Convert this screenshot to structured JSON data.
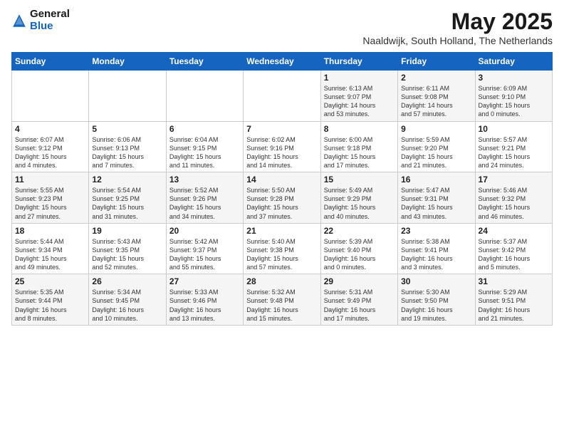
{
  "logo": {
    "general": "General",
    "blue": "Blue"
  },
  "title": "May 2025",
  "subtitle": "Naaldwijk, South Holland, The Netherlands",
  "days_of_week": [
    "Sunday",
    "Monday",
    "Tuesday",
    "Wednesday",
    "Thursday",
    "Friday",
    "Saturday"
  ],
  "weeks": [
    [
      {
        "day": "",
        "info": ""
      },
      {
        "day": "",
        "info": ""
      },
      {
        "day": "",
        "info": ""
      },
      {
        "day": "",
        "info": ""
      },
      {
        "day": "1",
        "info": "Sunrise: 6:13 AM\nSunset: 9:07 PM\nDaylight: 14 hours\nand 53 minutes."
      },
      {
        "day": "2",
        "info": "Sunrise: 6:11 AM\nSunset: 9:08 PM\nDaylight: 14 hours\nand 57 minutes."
      },
      {
        "day": "3",
        "info": "Sunrise: 6:09 AM\nSunset: 9:10 PM\nDaylight: 15 hours\nand 0 minutes."
      }
    ],
    [
      {
        "day": "4",
        "info": "Sunrise: 6:07 AM\nSunset: 9:12 PM\nDaylight: 15 hours\nand 4 minutes."
      },
      {
        "day": "5",
        "info": "Sunrise: 6:06 AM\nSunset: 9:13 PM\nDaylight: 15 hours\nand 7 minutes."
      },
      {
        "day": "6",
        "info": "Sunrise: 6:04 AM\nSunset: 9:15 PM\nDaylight: 15 hours\nand 11 minutes."
      },
      {
        "day": "7",
        "info": "Sunrise: 6:02 AM\nSunset: 9:16 PM\nDaylight: 15 hours\nand 14 minutes."
      },
      {
        "day": "8",
        "info": "Sunrise: 6:00 AM\nSunset: 9:18 PM\nDaylight: 15 hours\nand 17 minutes."
      },
      {
        "day": "9",
        "info": "Sunrise: 5:59 AM\nSunset: 9:20 PM\nDaylight: 15 hours\nand 21 minutes."
      },
      {
        "day": "10",
        "info": "Sunrise: 5:57 AM\nSunset: 9:21 PM\nDaylight: 15 hours\nand 24 minutes."
      }
    ],
    [
      {
        "day": "11",
        "info": "Sunrise: 5:55 AM\nSunset: 9:23 PM\nDaylight: 15 hours\nand 27 minutes."
      },
      {
        "day": "12",
        "info": "Sunrise: 5:54 AM\nSunset: 9:25 PM\nDaylight: 15 hours\nand 31 minutes."
      },
      {
        "day": "13",
        "info": "Sunrise: 5:52 AM\nSunset: 9:26 PM\nDaylight: 15 hours\nand 34 minutes."
      },
      {
        "day": "14",
        "info": "Sunrise: 5:50 AM\nSunset: 9:28 PM\nDaylight: 15 hours\nand 37 minutes."
      },
      {
        "day": "15",
        "info": "Sunrise: 5:49 AM\nSunset: 9:29 PM\nDaylight: 15 hours\nand 40 minutes."
      },
      {
        "day": "16",
        "info": "Sunrise: 5:47 AM\nSunset: 9:31 PM\nDaylight: 15 hours\nand 43 minutes."
      },
      {
        "day": "17",
        "info": "Sunrise: 5:46 AM\nSunset: 9:32 PM\nDaylight: 15 hours\nand 46 minutes."
      }
    ],
    [
      {
        "day": "18",
        "info": "Sunrise: 5:44 AM\nSunset: 9:34 PM\nDaylight: 15 hours\nand 49 minutes."
      },
      {
        "day": "19",
        "info": "Sunrise: 5:43 AM\nSunset: 9:35 PM\nDaylight: 15 hours\nand 52 minutes."
      },
      {
        "day": "20",
        "info": "Sunrise: 5:42 AM\nSunset: 9:37 PM\nDaylight: 15 hours\nand 55 minutes."
      },
      {
        "day": "21",
        "info": "Sunrise: 5:40 AM\nSunset: 9:38 PM\nDaylight: 15 hours\nand 57 minutes."
      },
      {
        "day": "22",
        "info": "Sunrise: 5:39 AM\nSunset: 9:40 PM\nDaylight: 16 hours\nand 0 minutes."
      },
      {
        "day": "23",
        "info": "Sunrise: 5:38 AM\nSunset: 9:41 PM\nDaylight: 16 hours\nand 3 minutes."
      },
      {
        "day": "24",
        "info": "Sunrise: 5:37 AM\nSunset: 9:42 PM\nDaylight: 16 hours\nand 5 minutes."
      }
    ],
    [
      {
        "day": "25",
        "info": "Sunrise: 5:35 AM\nSunset: 9:44 PM\nDaylight: 16 hours\nand 8 minutes."
      },
      {
        "day": "26",
        "info": "Sunrise: 5:34 AM\nSunset: 9:45 PM\nDaylight: 16 hours\nand 10 minutes."
      },
      {
        "day": "27",
        "info": "Sunrise: 5:33 AM\nSunset: 9:46 PM\nDaylight: 16 hours\nand 13 minutes."
      },
      {
        "day": "28",
        "info": "Sunrise: 5:32 AM\nSunset: 9:48 PM\nDaylight: 16 hours\nand 15 minutes."
      },
      {
        "day": "29",
        "info": "Sunrise: 5:31 AM\nSunset: 9:49 PM\nDaylight: 16 hours\nand 17 minutes."
      },
      {
        "day": "30",
        "info": "Sunrise: 5:30 AM\nSunset: 9:50 PM\nDaylight: 16 hours\nand 19 minutes."
      },
      {
        "day": "31",
        "info": "Sunrise: 5:29 AM\nSunset: 9:51 PM\nDaylight: 16 hours\nand 21 minutes."
      }
    ]
  ]
}
